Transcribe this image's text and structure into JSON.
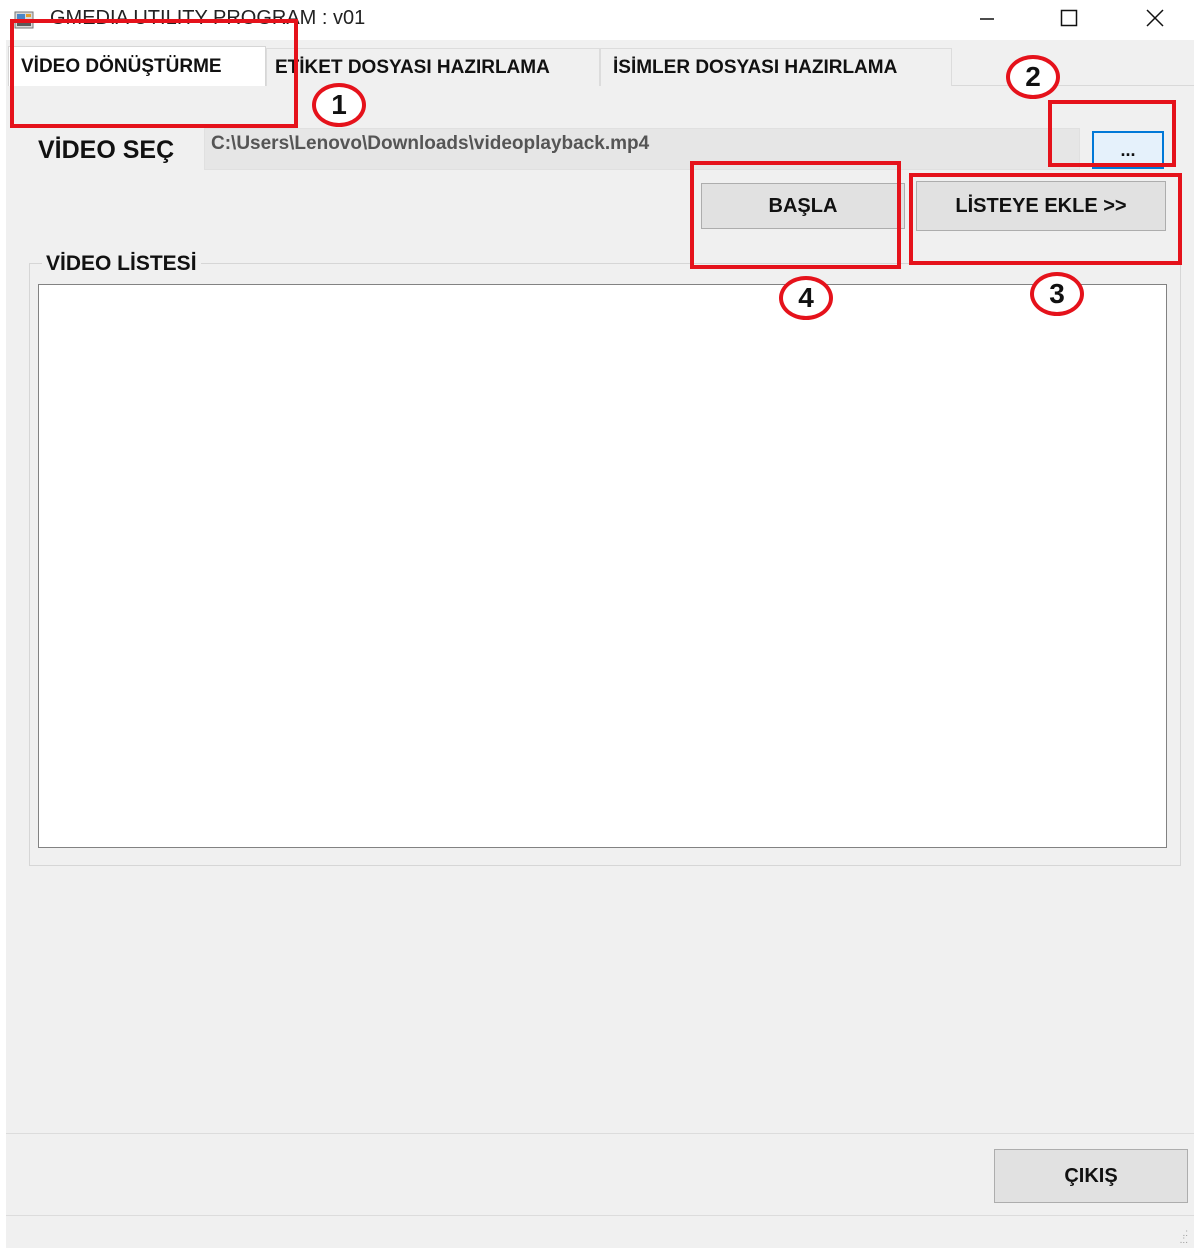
{
  "window": {
    "title": "GMEDIA UTILITY PROGRAM : v01",
    "controls": {
      "minimize_icon": "minimize-icon",
      "maximize_icon": "maximize-icon",
      "close_icon": "close-icon"
    }
  },
  "tabs": [
    {
      "label": "VİDEO DÖNÜŞTÜRME",
      "active": true
    },
    {
      "label": "ETİKET DOSYASI HAZIRLAMA",
      "active": false
    },
    {
      "label": "İSİMLER DOSYASI HAZIRLAMA",
      "active": false
    }
  ],
  "video_select": {
    "label": "VİDEO SEÇ",
    "path_value": "C:\\Users\\Lenovo\\Downloads\\videoplayback.mp4",
    "browse_label": "..."
  },
  "actions": {
    "start_label": "BAŞLA",
    "add_to_list_label": "LİSTEYE EKLE  >>"
  },
  "video_list": {
    "title": "VİDEO LİSTESİ",
    "items": []
  },
  "footer": {
    "exit_label": "ÇIKIŞ"
  },
  "annotations": [
    {
      "number": "1"
    },
    {
      "number": "2"
    },
    {
      "number": "3"
    },
    {
      "number": "4"
    }
  ],
  "colors": {
    "annotation": "#e5121b",
    "window_bg": "#f0f0f0",
    "focus_border": "#0078d7"
  }
}
